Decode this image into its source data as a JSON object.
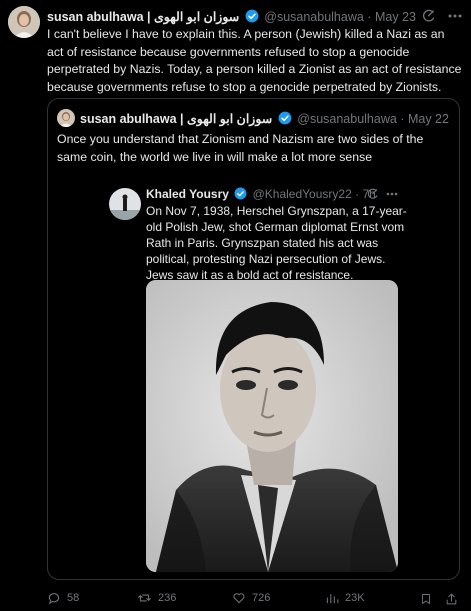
{
  "main_post": {
    "display_name": "susan abulhawa | سوزان ابو الهوى",
    "handle": "@susanabulhawa",
    "separator": "·",
    "date": "May 23",
    "text": "I can't believe I have to explain this. A person (Jewish) killed a Nazi as an act of resistance because governments refused to stop a genocide perpetrated by Nazis. Today, a person killed a Zionist as an act of resistance because governments refuse to stop a genocide perpetrated by Zionists."
  },
  "quoted_post": {
    "display_name": "susan abulhawa | سوزان ابو الهوى",
    "handle": "@susanabulhawa",
    "separator": "·",
    "date": "May 22",
    "text": "Once you understand that Zionism and Nazism are two sides of the same coin, the world we live in will make a lot more sense"
  },
  "nested_post": {
    "display_name": "Khaled Yousry",
    "handle": "@KhaledYousry22",
    "separator": "·",
    "time": "7h",
    "text": "On Nov 7, 1938, Herschel Grynszpan, a 17-year-old Polish Jew, shot German diplomat Ernst vom Rath in Paris. Grynszpan stated his act was political, protesting Nazi persecution of Jews. Jews saw it as a bold act of resistance."
  },
  "actions": {
    "replies": "58",
    "reposts": "236",
    "likes": "726",
    "views": "23K"
  },
  "colors": {
    "background": "#000000",
    "text": "#e7e9ea",
    "muted": "#71767b",
    "verified": "#1d9bf0",
    "border": "#2f3336"
  },
  "icons": {
    "grok": "grok-icon",
    "more": "more-icon",
    "verified": "verified-badge-icon",
    "reply": "reply-icon",
    "repost": "repost-icon",
    "like": "like-icon",
    "views": "views-icon",
    "bookmark": "bookmark-icon",
    "share": "share-icon"
  }
}
